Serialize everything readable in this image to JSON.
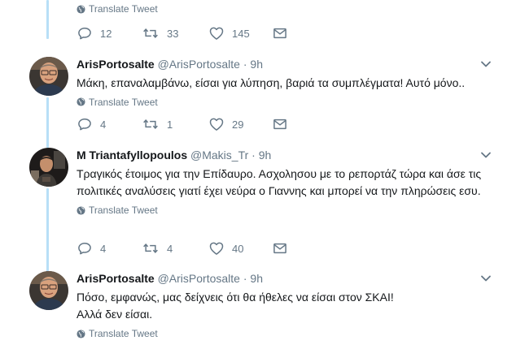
{
  "colors": {
    "thread_line": "#b8dff7",
    "secondary_text": "#657786",
    "primary_text": "#14171a"
  },
  "top_fragment": {
    "translate_label": "Translate Tweet",
    "replies": "12",
    "retweets": "33",
    "likes": "145"
  },
  "tweets": [
    {
      "name": "ArisPortosalte",
      "handle": "@ArisPortosalte",
      "separator": "·",
      "time": "9h",
      "text": "Μάκη, επαναλαμβάνω, είσαι για λύπηση, βαριά τα συμπλέγματα! Αυτό μόνο..",
      "translate_label": "Translate Tweet",
      "replies": "4",
      "retweets": "1",
      "likes": "29",
      "avatar_icon": "avatar-photo"
    },
    {
      "name": "M Triantafyllopoulos",
      "handle": "@Makis_Tr",
      "separator": "·",
      "time": "9h",
      "text": "Τραγικός έτοιμος για την Επίδαυρο. Ασχολησου με το ρεπορτάζ τώρα και άσε τις πολιτικές αναλύσεις γιατί έχει νεύρα ο Γιαννης και μπορεί να την πληρώσεις εσυ.",
      "translate_label": "Translate Tweet",
      "replies": "4",
      "retweets": "4",
      "likes": "40",
      "avatar_icon": "avatar-photo"
    },
    {
      "name": "ArisPortosalte",
      "handle": "@ArisPortosalte",
      "separator": "·",
      "time": "9h",
      "text_line1": "Πόσο, εμφανώς, μας δείχνεις ότι θα ήθελες να είσαι στον ΣΚΑΙ!",
      "text_line2": "Αλλά δεν είσαι.",
      "translate_label": "Translate Tweet",
      "avatar_icon": "avatar-photo"
    }
  ],
  "icons": {
    "reply": "reply-icon",
    "retweet": "retweet-icon",
    "like": "heart-icon",
    "message": "envelope-icon",
    "globe": "globe-icon",
    "caret": "chevron-down-icon"
  }
}
